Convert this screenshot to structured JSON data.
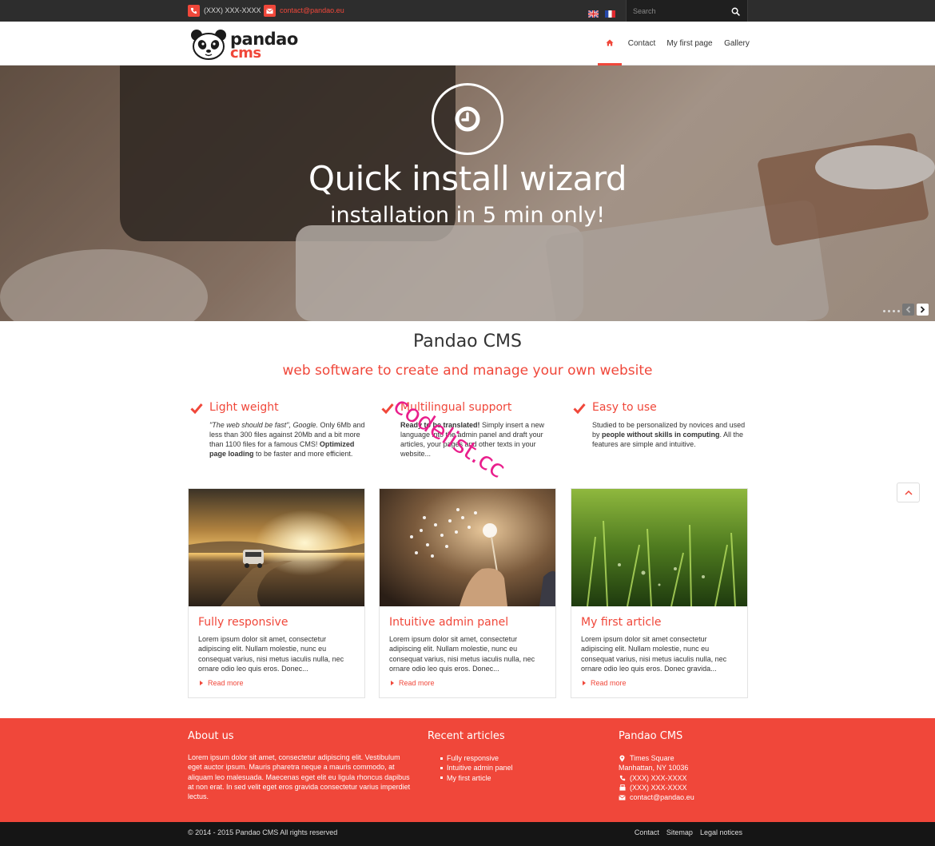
{
  "topbar": {
    "phone": "(XXX) XXX-XXXX",
    "email": "contact@pandao.eu",
    "search_placeholder": "Search"
  },
  "header": {
    "logo_word1": "pandao",
    "logo_word2": "cms",
    "nav": {
      "contact": "Contact",
      "first_page": "My first page",
      "gallery": "Gallery"
    }
  },
  "hero": {
    "title": "Quick install wizard",
    "subtitle": "installation in 5 min only!"
  },
  "intro": {
    "title": "Pandao CMS",
    "subtitle": "web software to create and manage your own website"
  },
  "features": [
    {
      "title": "Light weight",
      "quote": "\"The web should be fast\", Google.",
      "text_a": " Only 6Mb and less than 300 files against 20Mb and a bit more than 1100 files for a famous CMS! ",
      "strong": "Optimized page loading",
      "text_b": " to be faster and more efficient."
    },
    {
      "title": "Multilingual support",
      "strong": "Ready to be translated!",
      "text_b": " Simply insert a new language into the admin panel and draft your articles, your pages and other texts in your website..."
    },
    {
      "title": "Easy to use",
      "text_a": "Studied to be personalized by novices and used by ",
      "strong": "people without skills in computing",
      "text_b": ". All the features are simple and intuitive."
    }
  ],
  "watermark": "codelist.cc",
  "cards": [
    {
      "title": "Fully responsive",
      "text": "Lorem ipsum dolor sit amet, consectetur adipiscing elit. Nullam molestie, nunc eu consequat varius, nisi metus iaculis nulla, nec ornare odio leo quis eros. Donec...",
      "more": "Read more"
    },
    {
      "title": "Intuitive admin panel",
      "text": "Lorem ipsum dolor sit amet, consectetur adipiscing elit. Nullam molestie, nunc eu consequat varius, nisi metus iaculis nulla, nec ornare odio leo quis eros. Donec...",
      "more": "Read more"
    },
    {
      "title": "My first article",
      "text": "Lorem ipsum dolor sit amet consectetur adipiscing elit. Nullam molestie, nunc eu consequat varius, nisi metus iaculis nulla, nec ornare odio leo quis eros. Donec gravida...",
      "more": "Read more"
    }
  ],
  "footer": {
    "about_title": "About us",
    "about_text": "Lorem ipsum dolor sit amet, consectetur adipiscing elit. Vestibulum eget auctor ipsum. Mauris pharetra neque a mauris commodo, at aliquam leo malesuada. Maecenas eget elit eu ligula rhoncus dapibus at non erat. In sed velit eget eros gravida consectetur varius imperdiet lectus.",
    "recent_title": "Recent articles",
    "recent": [
      "Fully responsive",
      "Intuitive admin panel",
      "My first article"
    ],
    "cms_title": "Pandao CMS",
    "address1": "Times Square",
    "address2": "Manhattan, NY 10036",
    "phone": "(XXX) XXX-XXXX",
    "fax": "(XXX) XXX-XXXX",
    "email": "contact@pandao.eu"
  },
  "bottom": {
    "copyright": "© 2014 - 2015 Pandao CMS All rights reserved",
    "links": [
      "Contact",
      "Sitemap",
      "Legal notices"
    ]
  },
  "colors": {
    "accent": "#f0473a",
    "topbar": "#2d2d2d",
    "bottombar": "#151515"
  }
}
